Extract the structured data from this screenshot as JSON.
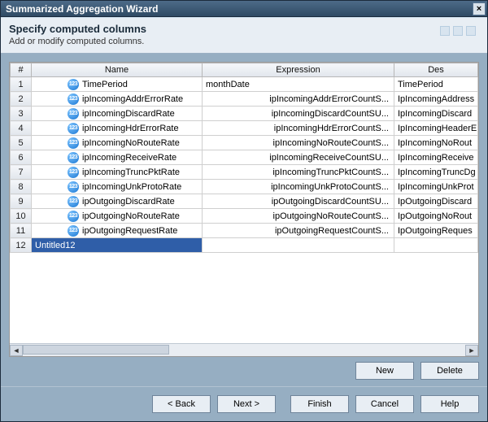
{
  "window": {
    "title": "Summarized Aggregation Wizard"
  },
  "header": {
    "title": "Specify computed columns",
    "subtitle": "Add or modify computed columns."
  },
  "columns": {
    "rownum": "#",
    "name": "Name",
    "expression": "Expression",
    "description": "Des"
  },
  "rows": [
    {
      "idx": "1",
      "name": "TimePeriod",
      "expr": "monthDate",
      "expr_align": "left",
      "desc": "TimePeriod"
    },
    {
      "idx": "2",
      "name": "ipIncomingAddrErrorRate",
      "expr": "ipIncomingAddrErrorCountS...",
      "expr_align": "right",
      "desc": "IpIncomingAddress"
    },
    {
      "idx": "3",
      "name": "ipIncomingDiscardRate",
      "expr": "ipIncomingDiscardCountSU...",
      "expr_align": "right",
      "desc": "IpIncomingDiscard"
    },
    {
      "idx": "4",
      "name": "ipIncomingHdrErrorRate",
      "expr": "ipIncomingHdrErrorCountS...",
      "expr_align": "right",
      "desc": "IpIncomingHeaderE"
    },
    {
      "idx": "5",
      "name": "ipIncomingNoRouteRate",
      "expr": "ipIncomingNoRouteCountS...",
      "expr_align": "right",
      "desc": "IpIncomingNoRout"
    },
    {
      "idx": "6",
      "name": "ipIncomingReceiveRate",
      "expr": "ipIncomingReceiveCountSU...",
      "expr_align": "right",
      "desc": "IpIncomingReceive"
    },
    {
      "idx": "7",
      "name": "ipIncomingTruncPktRate",
      "expr": "ipIncomingTruncPktCountS...",
      "expr_align": "right",
      "desc": "IpIncomingTruncDg"
    },
    {
      "idx": "8",
      "name": "ipIncomingUnkProtoRate",
      "expr": "ipIncomingUnkProtoCountS...",
      "expr_align": "right",
      "desc": "IpIncomingUnkProt"
    },
    {
      "idx": "9",
      "name": "ipOutgoingDiscardRate",
      "expr": "ipOutgoingDiscardCountSU...",
      "expr_align": "right",
      "desc": "IpOutgoingDiscard"
    },
    {
      "idx": "10",
      "name": "ipOutgoingNoRouteRate",
      "expr": "ipOutgoingNoRouteCountS...",
      "expr_align": "right",
      "desc": "IpOutgoingNoRout"
    },
    {
      "idx": "11",
      "name": "ipOutgoingRequestRate",
      "expr": "ipOutgoingRequestCountS...",
      "expr_align": "right",
      "desc": "IpOutgoingReques"
    }
  ],
  "editing_row": {
    "idx": "12",
    "value": "Untitled12"
  },
  "buttons": {
    "new": "New",
    "delete": "Delete",
    "back": "< Back",
    "next": "Next >",
    "finish": "Finish",
    "cancel": "Cancel",
    "help": "Help"
  },
  "icon_label": "123"
}
